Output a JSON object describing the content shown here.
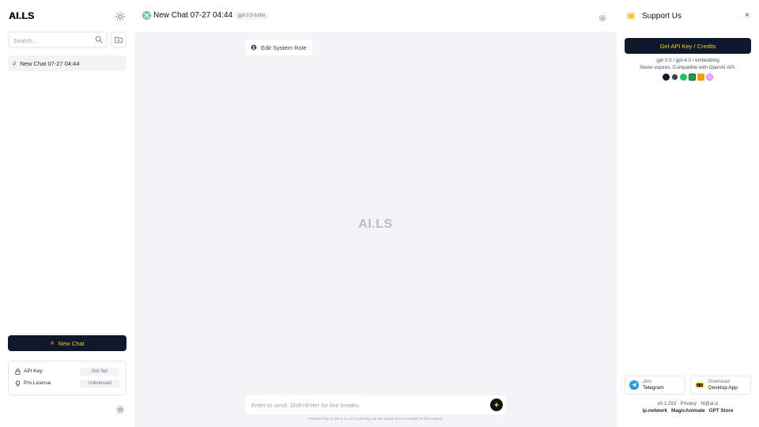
{
  "sidebar": {
    "logo_text": "AI.LS",
    "search": {
      "placeholder": "Search..."
    },
    "chats": [
      {
        "label": "New Chat 07-27 04:44"
      }
    ],
    "new_chat_label": "New Chat",
    "api_key": {
      "label": "API Key",
      "value": "Not Set"
    },
    "pro_license": {
      "label": "Pro License",
      "value": "Unlicensed"
    }
  },
  "header": {
    "title": "New Chat 07-27 04:44",
    "model": "gpt-3.5-turbo"
  },
  "main": {
    "edit_system_role_label": "Edit System Role",
    "watermark": "AI.LS",
    "input_placeholder": "Enter to send. Shift+Enter for line breaks.",
    "footer_note": "Powered by AI.SB & AI.LS (Currently we are using Gemini model for free users)"
  },
  "support": {
    "title": "Support Us",
    "close_label": "×",
    "get_api_label": "Get API Key / Credits",
    "models_line": "gpt-3.5 / gpt-4.0 / embedding",
    "compat_line": "Never expires. Compatible with OpenAI API.",
    "brand_icons": [
      "openai-icon",
      "cat-app-icon",
      "green-app-icon",
      "terminal-app-icon",
      "orange-app-icon",
      "pink-app-icon"
    ],
    "telegram": {
      "line1": "Join",
      "line2": "Telegram"
    },
    "desktop": {
      "line1": "Download",
      "line2": "Desktop App"
    },
    "version_line": "v0.1.293 · Privacy · hi@ai.ci",
    "links": [
      "ip.network",
      "MagicAnimate",
      "GPT Store"
    ]
  },
  "colors": {
    "accent_dark": "#0f172a",
    "accent_text": "#facc15",
    "main_bg": "#f3f4f6"
  }
}
